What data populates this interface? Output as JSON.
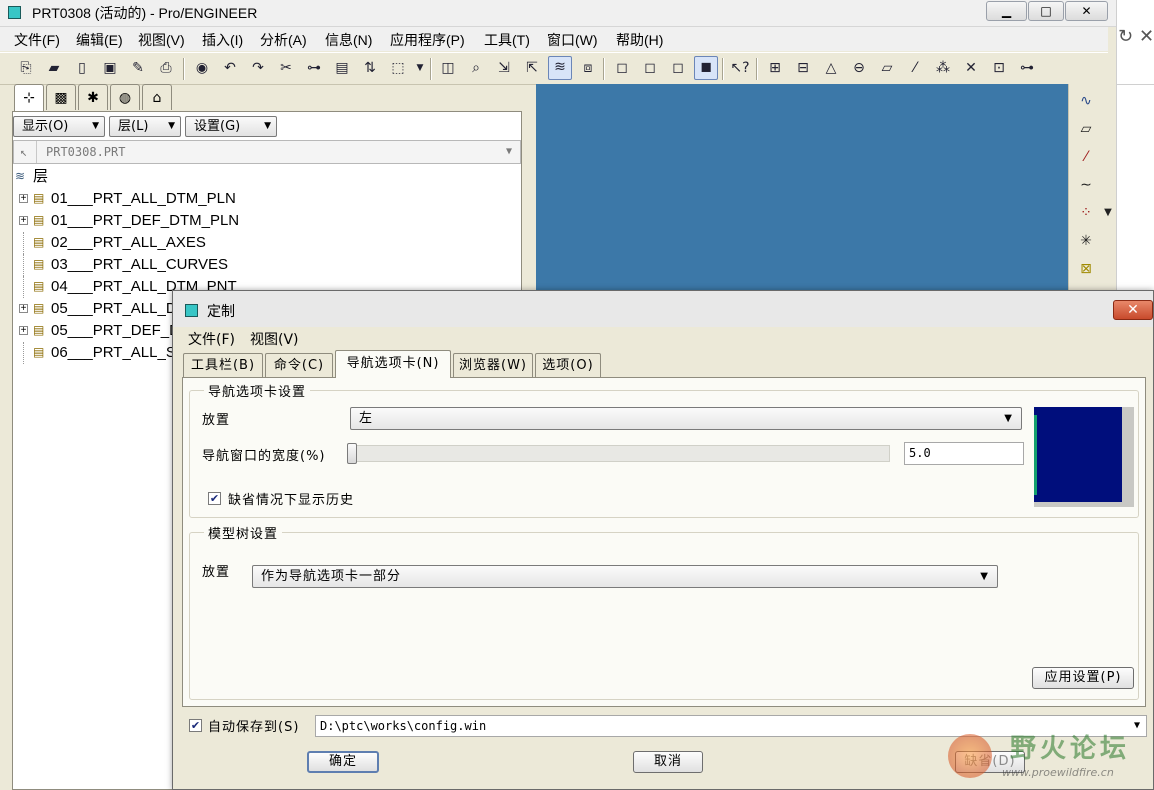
{
  "main_window": {
    "title": "PRT0308 (活动的) - Pro/ENGINEER",
    "controls": {
      "minimize": "▁",
      "maximize": "□",
      "close": "✕"
    },
    "menu": [
      "文件(F)",
      "编辑(E)",
      "视图(V)",
      "插入(I)",
      "分析(A)",
      "信息(N)",
      "应用程序(P)",
      "工具(T)",
      "窗口(W)",
      "帮助(H)"
    ]
  },
  "navigator": {
    "buttons": {
      "show": "显示(O)",
      "layer": "层(L)",
      "settings": "设置(G)"
    },
    "model_combo": "PRT0308.PRT",
    "tree_root": "层",
    "tree_items": [
      {
        "label": "01___PRT_ALL_DTM_PLN",
        "expandable": true
      },
      {
        "label": "01___PRT_DEF_DTM_PLN",
        "expandable": true
      },
      {
        "label": "02___PRT_ALL_AXES",
        "expandable": false
      },
      {
        "label": "03___PRT_ALL_CURVES",
        "expandable": false
      },
      {
        "label": "04___PRT_ALL_DTM_PNT",
        "expandable": false
      },
      {
        "label": "05___PRT_ALL_D",
        "expandable": true
      },
      {
        "label": "05___PRT_DEF_D",
        "expandable": true
      },
      {
        "label": "06___PRT_ALL_S",
        "expandable": false
      }
    ]
  },
  "dialog": {
    "title": "定制",
    "close": "✕",
    "menu": {
      "file": "文件(F)",
      "view": "视图(V)"
    },
    "tabs": {
      "toolbar": "工具栏(B)",
      "commands": "命令(C)",
      "nav_tabs": "导航选项卡(N)",
      "browser": "浏览器(W)",
      "options": "选项(O)"
    },
    "nav_group": {
      "title": "导航选项卡设置",
      "placement_label": "放置",
      "placement_value": "左",
      "width_label": "导航窗口的宽度(%)",
      "width_value": "5.0",
      "show_history_label": "缺省情况下显示历史",
      "show_history_checked": true
    },
    "model_tree_group": {
      "title": "模型树设置",
      "placement_label": "放置",
      "placement_value": "作为导航选项卡一部分"
    },
    "apply_button": "应用设置(P)",
    "autosave": {
      "label": "自动保存到(S)",
      "checked": true,
      "path": "D:\\ptc\\works\\config.win"
    },
    "ok_button": "确定",
    "cancel_button": "取消",
    "default_button": "缺省(D)"
  },
  "watermark": {
    "title": "野火论坛",
    "url": "www.proewildfire.cn"
  },
  "colors": {
    "graphics_bg": "#3c78a8",
    "preview_nav": "#000e7c",
    "close_red": "#c84a2c"
  }
}
